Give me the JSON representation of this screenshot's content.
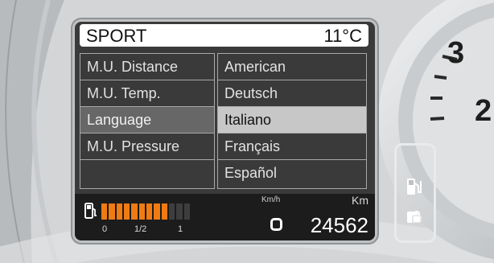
{
  "header": {
    "mode": "SPORT",
    "temperature": "11°C"
  },
  "menu": {
    "items": [
      {
        "label": "M.U. Distance",
        "selected": false
      },
      {
        "label": "M.U. Temp.",
        "selected": false
      },
      {
        "label": "Language",
        "selected": true
      },
      {
        "label": "M.U. Pressure",
        "selected": false
      },
      {
        "label": "",
        "selected": false
      }
    ]
  },
  "options": {
    "items": [
      {
        "label": "American",
        "selected": false
      },
      {
        "label": "Deutsch",
        "selected": false
      },
      {
        "label": "Italiano",
        "selected": true
      },
      {
        "label": "Français",
        "selected": false
      },
      {
        "label": "Español",
        "selected": false
      }
    ]
  },
  "status": {
    "fuel": {
      "level_fraction": 0.75,
      "segments_total": 12,
      "tick_labels": [
        "0",
        "1/2",
        "1"
      ]
    },
    "speed_unit": "Km/h",
    "speed_value": "0",
    "odometer_unit": "Km",
    "odometer_value": "24562"
  },
  "gauge": {
    "labels": [
      "3",
      "2"
    ]
  },
  "icons": {
    "fuel_icon": "fuel-pump-icon",
    "side_fuel_icon": "fuel-pump-icon",
    "side_lock_icon": "fuel-cap-lock-icon"
  },
  "colors": {
    "accent_orange": "#f07b12",
    "screen_bg": "#3a3a3a",
    "selected_option_bg": "#c7c7c7"
  }
}
